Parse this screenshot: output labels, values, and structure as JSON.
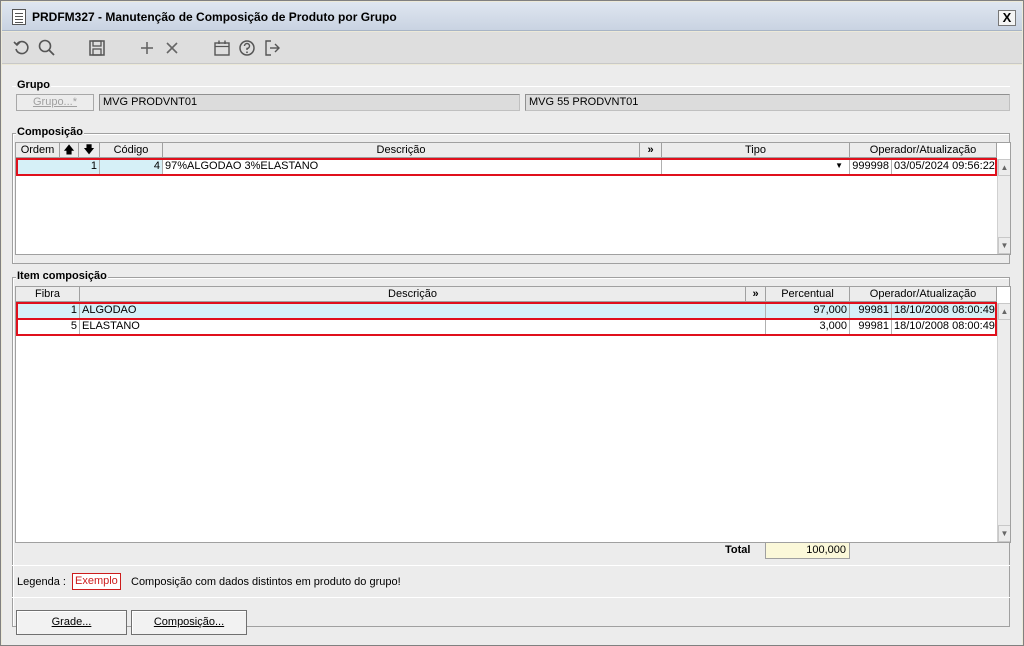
{
  "window": {
    "title": "PRDFM327 - Manutenção de Composição de Produto por Grupo",
    "close_label": "X"
  },
  "toolbar": {
    "icons": [
      "refresh-icon",
      "search-icon",
      "save-icon",
      "add-icon",
      "delete-icon",
      "calendar-icon",
      "help-icon",
      "exit-icon"
    ]
  },
  "grupo": {
    "label": "Grupo",
    "button_label": "Grupo...*",
    "code_value": "MVG PRODVNT01",
    "desc_value": "MVG 55 PRODVNT01"
  },
  "composicao": {
    "label": "Composição",
    "columns": [
      "Ordem",
      "Código",
      "Descrição",
      "»",
      "Tipo",
      "Operador/Atualização"
    ],
    "rows": [
      {
        "ordem": "1",
        "codigo": "4",
        "descricao": "97%ALGODAO 3%ELASTANO",
        "tipo": "",
        "operador": "999998",
        "atualizacao": "03/05/2024 09:56:22"
      }
    ]
  },
  "item_composicao": {
    "label": "Item composição",
    "columns": [
      "Fibra",
      "Descrição",
      "»",
      "Percentual",
      "Operador/Atualização"
    ],
    "rows": [
      {
        "fibra": "1",
        "descricao": "ALGODAO",
        "percentual": "97,000",
        "operador": "99981",
        "atualizacao": "18/10/2008 08:00:49"
      },
      {
        "fibra": "5",
        "descricao": "ELASTANO",
        "percentual": "3,000",
        "operador": "99981",
        "atualizacao": "18/10/2008 08:00:49"
      }
    ],
    "total_label": "Total",
    "total_value": "100,000"
  },
  "legend": {
    "label": "Legenda :",
    "sample": "Exemplo",
    "text": "Composição com dados distintos em produto do grupo!"
  },
  "buttons": {
    "grade": "Grade...",
    "composicao": "Composição..."
  },
  "colors": {
    "selected_row": "#d6f0f7",
    "highlight_border": "#e0101c",
    "total_bg": "#fbf8d9"
  }
}
